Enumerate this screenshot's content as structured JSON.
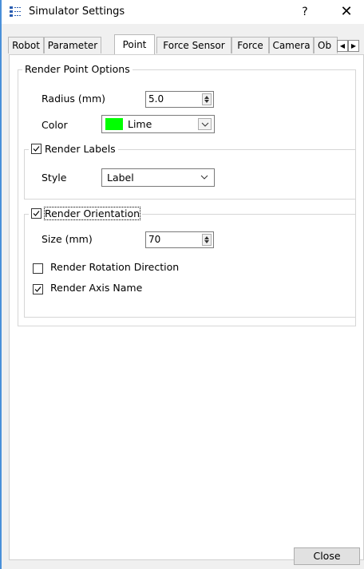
{
  "window": {
    "title": "Simulator Settings",
    "help_label": "?",
    "close_label": "✕"
  },
  "tabs": [
    {
      "label": "Robot"
    },
    {
      "label": "Parameter"
    },
    {
      "label": "Point",
      "active": true
    },
    {
      "label": "Force Sensor"
    },
    {
      "label": "Force"
    },
    {
      "label": "Camera"
    },
    {
      "label": "Ob"
    }
  ],
  "render_point_options": {
    "legend": "Render Point Options",
    "radius_label": "Radius (mm)",
    "radius_value": "5.0",
    "color_label": "Color",
    "color_value": "Lime",
    "color_hex": "#00ff00"
  },
  "render_labels": {
    "label": "Render Labels",
    "checked": true,
    "style_label": "Style",
    "style_value": "Label"
  },
  "render_orientation": {
    "label": "Render Orientation",
    "checked": true,
    "size_label": "Size (mm)",
    "size_value": "70"
  },
  "render_rotation_direction": {
    "label": "Render Rotation Direction",
    "checked": false
  },
  "render_axis_name": {
    "label": "Render Axis Name",
    "checked": true
  },
  "footer": {
    "close_button": "Close"
  },
  "colors": {
    "accent": "#4a90d9",
    "lime": "#00ff00"
  }
}
